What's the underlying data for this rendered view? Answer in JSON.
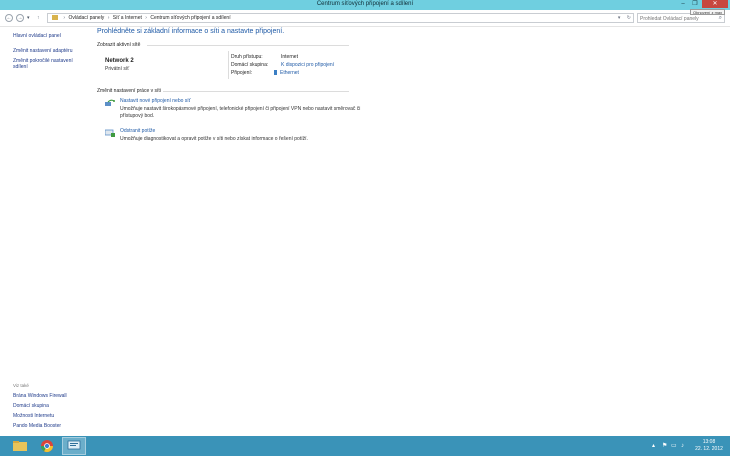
{
  "window": {
    "title": "Centrum síťových připojení a sdílení",
    "tooltip": "Obnovení z max"
  },
  "address_bar": {
    "crumbs": [
      "Ovládací panely",
      "Síť a Internet",
      "Centrum síťových připojení a sdílení"
    ],
    "search_placeholder": "Prohledat Ovládací panely"
  },
  "left_pane": {
    "home": "Hlavní ovládací panel",
    "links": [
      "Změnit nastavení adaptéru",
      "Změnit pokročilé nastavení sdílení"
    ],
    "see_also_title": "Viz také",
    "see_also": [
      "Brána Windows Firewall",
      "Domácí skupina",
      "Možnosti Internetu",
      "Pando Media Booster"
    ]
  },
  "main": {
    "heading": "Prohlédněte si základní informace o síti a nastavte připojení.",
    "active_networks_label": "Zobrazit aktivní sítě",
    "network_name": "Network 2",
    "network_type": "Privátní síť",
    "props": [
      {
        "label": "Druh přístupu:",
        "value": "Internet"
      },
      {
        "label": "Domácí skupina:",
        "value": "K dispozici pro připojení"
      },
      {
        "label": "Připojení:",
        "value": "Ethernet"
      }
    ],
    "change_settings_label": "Změnit nastavení práce v síti",
    "tasks": [
      {
        "title": "Nastavit nové připojení nebo síť",
        "desc": "Umožňuje nastavit širokopásmové připojení, telefonické připojení či připojení VPN nebo nastavit směrovač či přístupový bod."
      },
      {
        "title": "Odstranit potíže",
        "desc": "Umožňuje diagnostikovat a opravit potíže v síti nebo získat informace o řešení potíží."
      }
    ]
  },
  "taskbar": {
    "time": "13:08",
    "date": "22. 12. 2012"
  },
  "colors": {
    "titlebar": "#6fcfe0",
    "taskbar": "#3a93b8",
    "link": "#1f5aa6",
    "close": "#c7473e"
  }
}
